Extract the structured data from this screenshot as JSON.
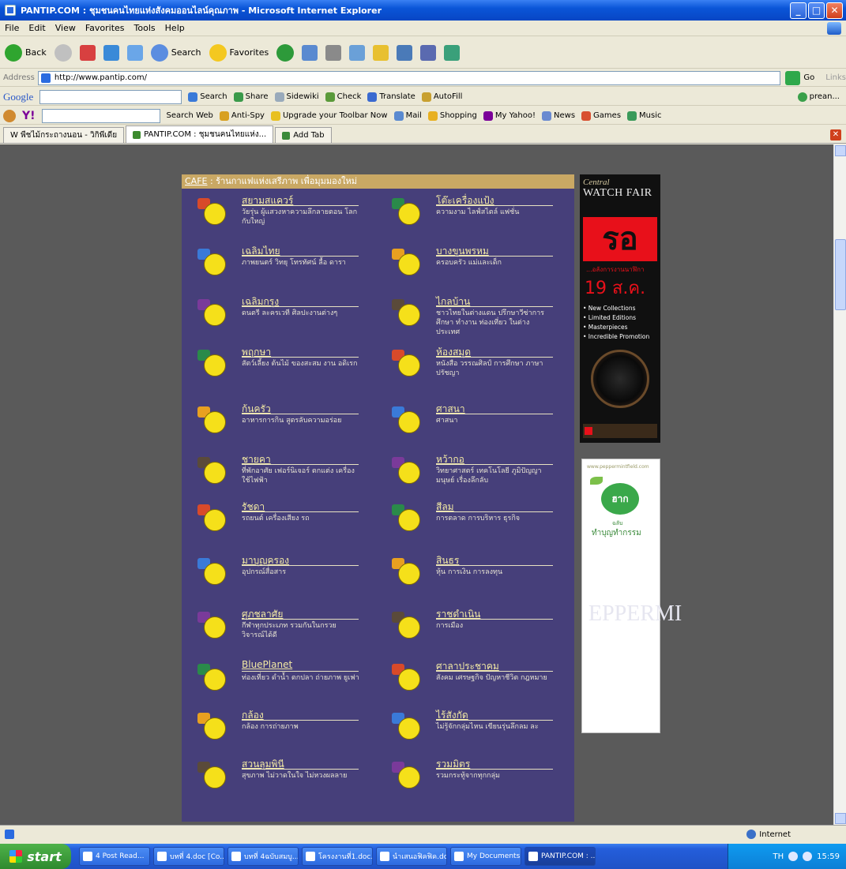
{
  "window": {
    "title": "PANTIP.COM : ชุมชนคนไทยแห่งสังคมออนไลน์คุณภาพ - Microsoft Internet Explorer"
  },
  "menu": [
    "File",
    "Edit",
    "View",
    "Favorites",
    "Tools",
    "Help"
  ],
  "toolbar": {
    "back": "Back",
    "search": "Search",
    "favorites": "Favorites"
  },
  "address": {
    "label": "Address",
    "url": "http://www.pantip.com/",
    "go": "Go",
    "links": "Links"
  },
  "googlebar": {
    "logo": "Google",
    "items": [
      "Search",
      "Share",
      "Sidewiki",
      "Check",
      "Translate",
      "AutoFill"
    ],
    "account": "prean..."
  },
  "yahoobar": {
    "items": [
      "Search Web",
      "Anti-Spy",
      "Upgrade your Toolbar Now",
      "Mail",
      "Shopping",
      "My Yahoo!",
      "News",
      "Games",
      "Music"
    ]
  },
  "tabs": [
    {
      "label": "W พืชไม้กระถางนอน - วิกิพีเดีย"
    },
    {
      "label": "PANTIP.COM : ชุมชนคนไทยแห่ง..."
    },
    {
      "label": "Add Tab"
    }
  ],
  "cafe": {
    "header_tag": "CAFE",
    "header_text": " : ร้านกาแฟแห่งเสรีภาพ เพื่อมุมมองใหม่"
  },
  "forums_left": [
    {
      "name": "สยามสแควร์",
      "desc": "วัยรุ่น ผู้แสวงหาความลึกลายตอน โลกกับใหญ่"
    },
    {
      "name": "เฉลิมไทย",
      "desc": "ภาพยนตร์ วิทยุ โทรทัศน์ ลื้อ ดารา"
    },
    {
      "name": "เฉลิมกรุง",
      "desc": "ดนตรี ละครเวที ศิลปะงานต่างๆ"
    },
    {
      "name": "พฤกษา",
      "desc": "สัตว์เลี้ยง ต้นไม้ ของสะสม งาน อดิเรก"
    },
    {
      "name": "ก้นครัว",
      "desc": "อาหารการกิน สูตรลับความอร่อย"
    },
    {
      "name": "ชายคา",
      "desc": "ที่พักอาศัย เฟอร์นิเจอร์ ตกแต่ง เครื่องใช้ไฟฟ้า"
    },
    {
      "name": "รัชดา",
      "desc": "รถยนต์ เครื่องเสียง รถ"
    },
    {
      "name": "มาบุญครอง",
      "desc": "อุปกรณ์สื่อสาร"
    },
    {
      "name": "ศุภชลาศัย",
      "desc": "กีฬาทุกประเภท รวมกันในกรวย วิจารณ์ได้ดี"
    },
    {
      "name": "BluePlanet",
      "desc": "ท่องเที่ยว ดำน้ำ ตกปลา ถ่ายภาพ ยูเฟา"
    },
    {
      "name": "กล้อง",
      "desc": "กล้อง การถ่ายภาพ"
    },
    {
      "name": "สวนลุมพินี",
      "desc": "สุขภาพ ไม่วาดในใจ ไม่หวงผลลาย"
    }
  ],
  "forums_right": [
    {
      "name": "โต๊ะเครื่องแป้ง",
      "desc": "ความงาม ไลฟ์สไตล์ แฟชั่น"
    },
    {
      "name": "บางขุนพรหม",
      "desc": "ครอบครัว แม่และเด็ก"
    },
    {
      "name": "ไกลบ้าน",
      "desc": "ชาวไทยในต่างแดน ปรึกษาวีซ่าการ ศึกษา ทำงาน ท่องเที่ยว ในต่าง ประเทศ"
    },
    {
      "name": "ห้องสมุด",
      "desc": "หนังสือ วรรณศิลป์ การศึกษา ภาษา ปรัชญา"
    },
    {
      "name": "ศาสนา",
      "desc": "ศาสนา"
    },
    {
      "name": "หว้ากอ",
      "desc": "วิทยาศาสตร์ เทคโนโลยี ภูมิปัญญา มนุษย์ เรื่องลึกลับ"
    },
    {
      "name": "สีลม",
      "desc": "การตลาด การบริหาร ธุรกิจ"
    },
    {
      "name": "สินธร",
      "desc": "หุ้น การเงิน การลงทุน"
    },
    {
      "name": "ราชดำเนิน",
      "desc": "การเมือง"
    },
    {
      "name": "ศาลาประชาคม",
      "desc": "สังคม เศรษฐกิจ ปัญหาชีวิต กฎหมาย"
    },
    {
      "name": "ไร้สังกัด",
      "desc": "ไม่รู้จักกลุ่มไหน เขียนรุ่นลึกลม ละ"
    },
    {
      "name": "รวมมิตร",
      "desc": "รวมกระทู้จากทุกกลุ่ม"
    }
  ],
  "ads": {
    "watch": {
      "brand": "Central",
      "title": "WATCH FAIR",
      "big": "รอ",
      "sub": "...อลังการงานนาฬิกา",
      "date": "19 ส.ค.",
      "bullets": [
        "• New Collections",
        "• Limited Editions",
        "• Masterpieces",
        "• Incredible Promotion"
      ]
    },
    "green": {
      "url": "www.peppermintfield.com",
      "badge": "ฮาก",
      "t1": "ฉลับ",
      "t2": "ทำบุญทำกรรม",
      "watermark": "EPPERMI"
    }
  },
  "status": {
    "zone": "Internet"
  },
  "taskbar": {
    "start": "start",
    "tasks": [
      "4 Post Read...",
      "บทที่ 4.doc [Co...",
      "บทที่ 4ฉบับสมบู...",
      "โครงงานที่1.doc...",
      "นำเสนอฟิคฟิค.do...",
      "My Documents",
      "PANTIP.COM : ..."
    ],
    "clock": "15:59",
    "lang": "TH"
  }
}
